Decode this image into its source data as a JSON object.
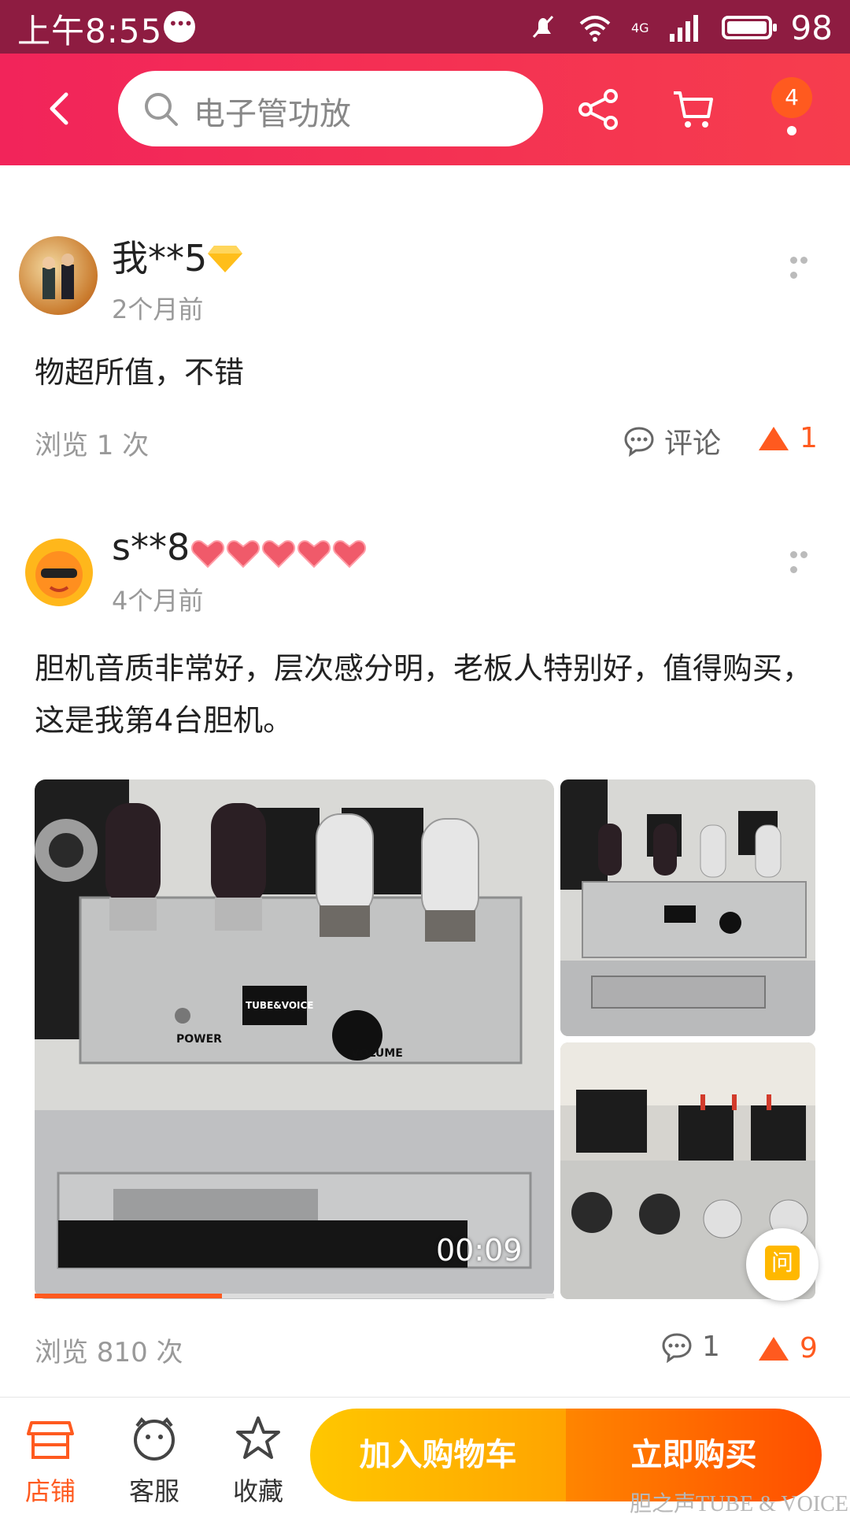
{
  "status_bar": {
    "time": "上午8:55",
    "network": "4G",
    "battery": "98"
  },
  "header": {
    "search_placeholder": "电子管功放",
    "badge_count": "4"
  },
  "reviews": [
    {
      "username": "我**5",
      "time": "2个月前",
      "content": "物超所值，不错",
      "views": "浏览 1 次",
      "comment_label": "评论",
      "likes": "1"
    },
    {
      "username": "s**8",
      "time": "4个月前",
      "content": "胆机音质非常好，层次感分明，老板人特别好，值得购买，这是我第4台胆机。",
      "media": {
        "video_time": "00:09",
        "video_progress": 0.36,
        "ask_label": "问"
      },
      "views": "浏览 810 次",
      "comments": "1",
      "likes": "9"
    }
  ],
  "photo_text": {
    "brand": "TUBE&VOICE",
    "power": "POWER",
    "volume": "VOLUME"
  },
  "bottom_bar": {
    "tabs": [
      {
        "label": "店铺",
        "icon": "store-icon"
      },
      {
        "label": "客服",
        "icon": "service-icon"
      },
      {
        "label": "收藏",
        "icon": "star-icon"
      }
    ],
    "add_to_cart": "加入购物车",
    "buy_now": "立即购买"
  },
  "watermark": "胆之声TUBE & VOICE",
  "colors": {
    "accent": "#ff5a1f",
    "header": "#f2245a",
    "status_bar": "#8e1c41"
  }
}
